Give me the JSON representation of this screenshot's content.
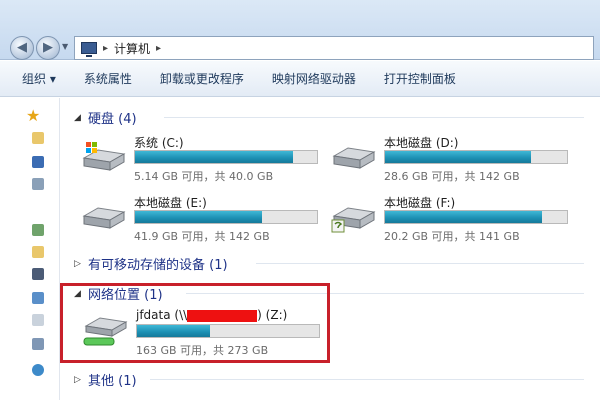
{
  "address": {
    "crumb": "计算机",
    "separator": "▸"
  },
  "toolbar": {
    "organize": "组织 ▾",
    "system_properties": "系统属性",
    "uninstall": "卸载或更改程序",
    "map_drive": "映射网络驱动器",
    "control_panel": "打开控制面板"
  },
  "groups": {
    "hdd": {
      "label": "硬盘 (4)",
      "toggle": "◢"
    },
    "removable": {
      "label": "有可移动存储的设备 (1)",
      "toggle": "▷"
    },
    "network": {
      "label": "网络位置 (1)",
      "toggle": "◢"
    },
    "other": {
      "label": "其他 (1)",
      "toggle": "▷"
    }
  },
  "drives": [
    {
      "name": "系统 (C:)",
      "info": "5.14 GB 可用，共 40.0 GB",
      "used_fraction": 0.87
    },
    {
      "name": "本地磁盘 (D:)",
      "info": "28.6 GB 可用，共 142 GB",
      "used_fraction": 0.8
    },
    {
      "name": "本地磁盘 (E:)",
      "info": "41.9 GB 可用，共 142 GB",
      "used_fraction": 0.7
    },
    {
      "name": "本地磁盘 (F:)",
      "info": "20.2 GB 可用，共 141 GB",
      "used_fraction": 0.86
    }
  ],
  "network_drive": {
    "name_prefix": "jfdata (\\\\",
    "name_suffix": ") (Z:)",
    "info": "163 GB 可用，共 273 GB",
    "used_fraction": 0.4
  },
  "colors": {
    "group_header": "#1e3287",
    "bar_fill": "#1c8fb3",
    "highlight": "#c8202a",
    "redaction": "#ee1111"
  }
}
